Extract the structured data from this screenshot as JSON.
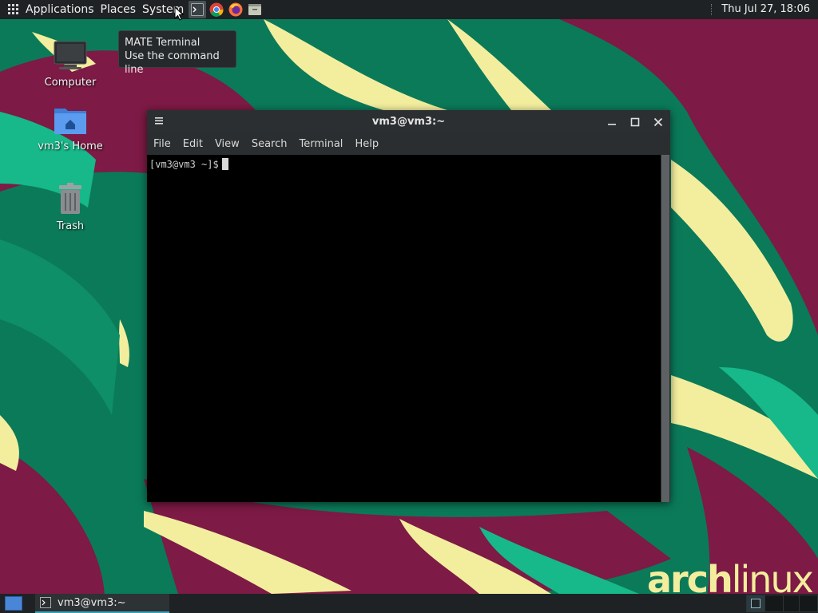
{
  "top_panel": {
    "menus": [
      "Applications",
      "Places",
      "System"
    ],
    "launchers": [
      "terminal-icon",
      "chrome-icon",
      "firefox-icon",
      "file-manager-icon"
    ],
    "clock": "Thu Jul 27, 18:06"
  },
  "tooltip": {
    "title": "MATE Terminal",
    "description": "Use the command line"
  },
  "desktop_icons": [
    {
      "label": "Computer",
      "icon": "computer-icon"
    },
    {
      "label": "vm3's Home",
      "icon": "home-folder-icon"
    },
    {
      "label": "Trash",
      "icon": "trash-icon"
    }
  ],
  "terminal": {
    "title": "vm3@vm3:~",
    "menu": [
      "File",
      "Edit",
      "View",
      "Search",
      "Terminal",
      "Help"
    ],
    "prompt": "[vm3@vm3 ~]$"
  },
  "bottom_panel": {
    "task_label": "vm3@vm3:~",
    "workspace_count": 4,
    "active_workspace": 1
  },
  "wallpaper": {
    "logo_text": "archlinux",
    "colors": {
      "green": "#0b7a59",
      "magenta": "#7d1a45",
      "yellow": "#f3ee9e",
      "teal": "#17b88a"
    }
  }
}
